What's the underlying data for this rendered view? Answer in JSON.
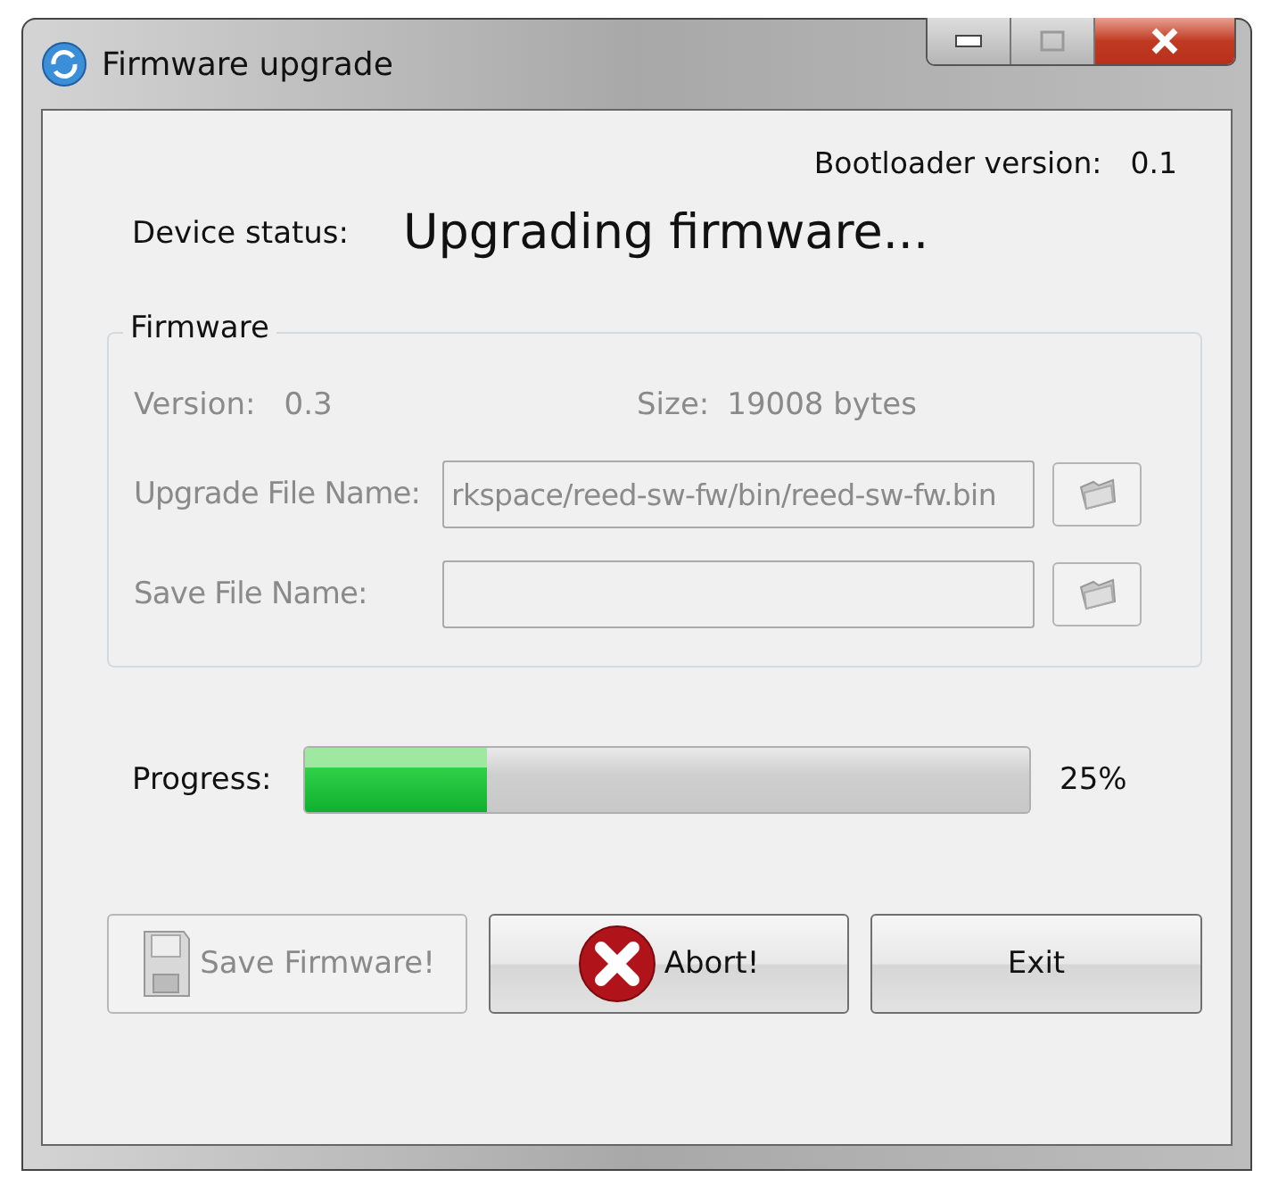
{
  "window": {
    "title": "Firmware upgrade"
  },
  "bootloader": {
    "label": "Bootloader version:",
    "value": "0.1"
  },
  "device_status": {
    "label": "Device status:",
    "value": "Upgrading firmware..."
  },
  "firmware": {
    "title": "Firmware",
    "disabled": true,
    "version": {
      "label": "Version:",
      "value": "0.3"
    },
    "size": {
      "label": "Size:",
      "value": "19008 bytes"
    },
    "files": [
      {
        "label": "Upgrade File Name:",
        "value": "rkspace/reed-sw-fw/bin/reed-sw-fw.bin"
      },
      {
        "label": "Save File Name:"
      }
    ]
  },
  "progress": {
    "label": "Progress:",
    "level": 0.25,
    "reading": "25%"
  },
  "buttons": [
    {
      "kind": "save",
      "label": "Save Firmware!",
      "disabled": true
    },
    {
      "kind": "abort",
      "label": "Abort!",
      "disabled": false
    },
    {
      "kind": "exit",
      "label": "Exit",
      "disabled": false
    }
  ]
}
